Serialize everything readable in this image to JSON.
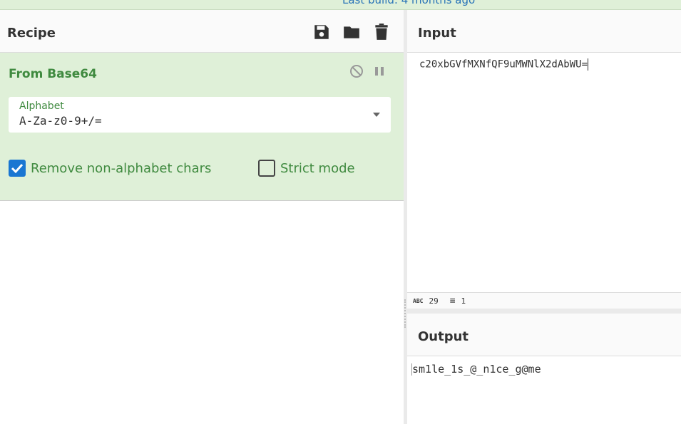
{
  "banner": {
    "text": "Last build: 4 months ago"
  },
  "recipe": {
    "title": "Recipe",
    "icons": [
      "save-icon",
      "folder-icon",
      "trash-icon"
    ]
  },
  "operation": {
    "title": "From Base64",
    "alphabet_label": "Alphabet",
    "alphabet_value": "A-Za-z0-9+/=",
    "remove_label": "Remove non-alphabet chars",
    "remove_checked": true,
    "strict_label": "Strict mode",
    "strict_checked": false
  },
  "input": {
    "title": "Input",
    "value": "c20xbGVfMXNfQF9uMWNlX2dAbWU=",
    "char_count": "29",
    "line_count": "1"
  },
  "output": {
    "title": "Output",
    "value": "sm1le_1s_@_n1ce_g@me"
  },
  "colors": {
    "accent_green": "#3f8a3f",
    "panel_green": "#dff0d8",
    "checkbox_blue": "#1976d2"
  }
}
